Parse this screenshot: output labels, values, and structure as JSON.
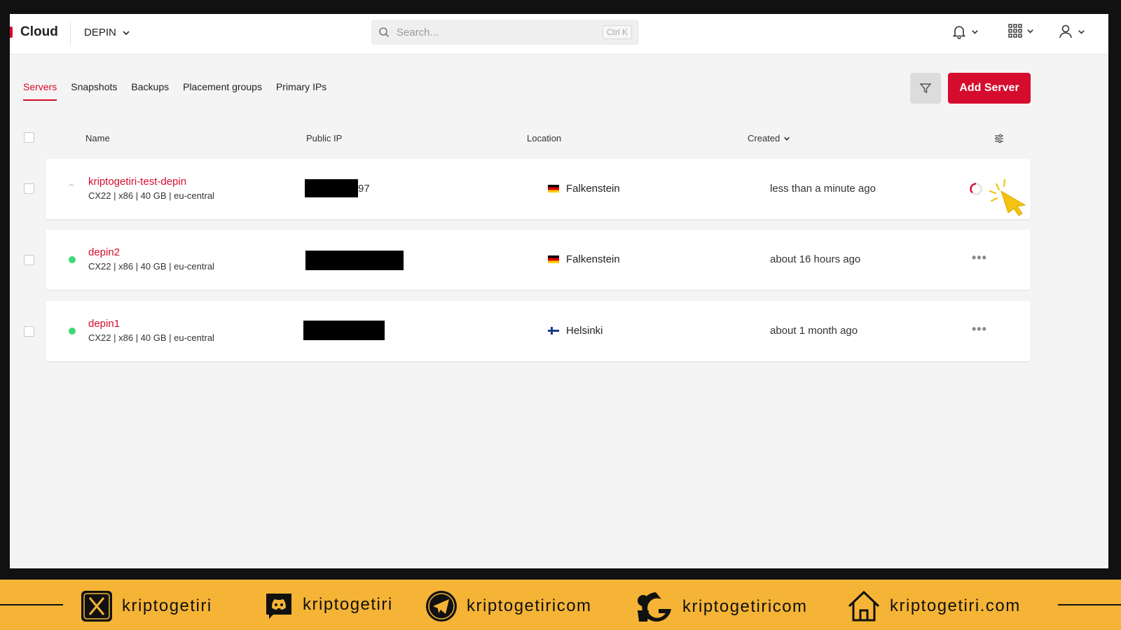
{
  "topbar": {
    "brand": "Cloud",
    "project": "DEPIN",
    "search_placeholder": "Search...",
    "search_shortcut": "Ctrl K"
  },
  "tabs": [
    {
      "label": "Servers",
      "active": true
    },
    {
      "label": "Snapshots"
    },
    {
      "label": "Backups"
    },
    {
      "label": "Placement groups"
    },
    {
      "label": "Primary IPs"
    }
  ],
  "actions": {
    "add_server": "Add Server"
  },
  "table": {
    "columns": {
      "name": "Name",
      "public_ip": "Public IP",
      "location": "Location",
      "created": "Created"
    },
    "rows": [
      {
        "name": "kriptogetiri-test-depin",
        "spec": "CX22 | x86 | 40 GB | eu-central",
        "ip_visible": "97",
        "location": "Falkenstein",
        "flag": "de",
        "created": "less than a minute ago",
        "status": "initializing"
      },
      {
        "name": "depin2",
        "spec": "CX22 | x86 | 40 GB | eu-central",
        "ip_visible": "",
        "location": "Falkenstein",
        "flag": "de",
        "created": "about 16 hours ago",
        "status": "running"
      },
      {
        "name": "depin1",
        "spec": "CX22 | x86 | 40 GB | eu-central",
        "ip_visible": "",
        "location": "Helsinki",
        "flag": "fi",
        "created": "about 1 month ago",
        "status": "running"
      }
    ],
    "more_label": "•••"
  },
  "banner": {
    "x": "kriptogetiri",
    "discord": "kriptogetiri",
    "telegram": "kriptogetiricom",
    "github": "kriptogetiricom",
    "website": "kriptogetiri.com"
  },
  "colors": {
    "accent": "#d50c2d",
    "status_running": "#3ed877",
    "banner": "#f5b436"
  }
}
